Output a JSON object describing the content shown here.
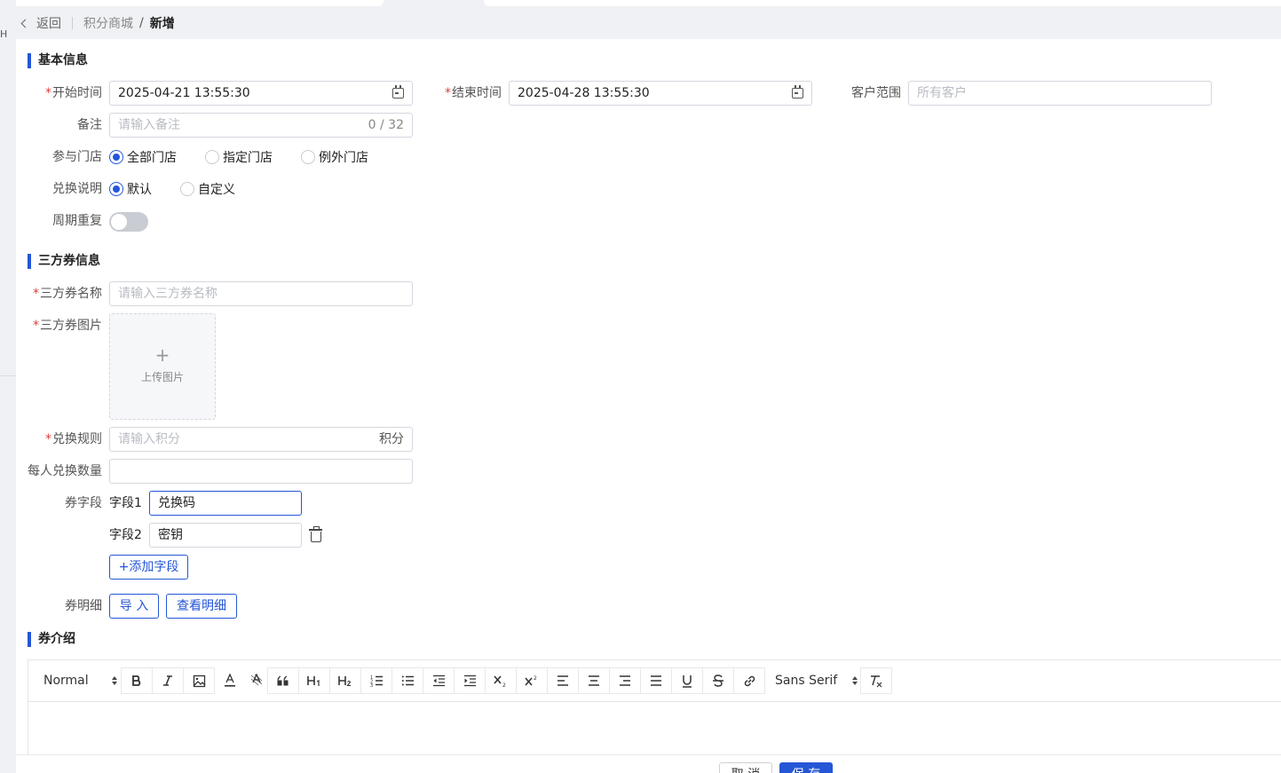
{
  "breadcrumb": {
    "back": "返回",
    "parent": "积分商城",
    "separator": "/",
    "current": "新增"
  },
  "left_edge_char": "H",
  "sections": {
    "basic": "基本信息",
    "coupon": "三方券信息",
    "intro": "券介绍"
  },
  "basic": {
    "start_time": {
      "label": "开始时间",
      "required": "*",
      "value": "2025-04-21 13:55:30"
    },
    "end_time": {
      "label": "结束时间",
      "required": "*",
      "value": "2025-04-28 13:55:30"
    },
    "customer_scope": {
      "label": "客户范围",
      "placeholder": "所有客户"
    },
    "remark": {
      "label": "备注",
      "placeholder": "请输入备注",
      "counter": "0 / 32"
    },
    "stores": {
      "label": "参与门店",
      "options": [
        "全部门店",
        "指定门店",
        "例外门店"
      ],
      "selected": "全部门店"
    },
    "exchange_desc": {
      "label": "兑换说明",
      "options": [
        "默认",
        "自定义"
      ],
      "selected": "默认"
    },
    "repeat": {
      "label": "周期重复",
      "on": false
    }
  },
  "coupon": {
    "name": {
      "label": "三方券名称",
      "required": "*",
      "placeholder": "请输入三方券名称"
    },
    "image": {
      "label": "三方券图片",
      "required": "*",
      "plus": "+",
      "upload_text": "上传图片"
    },
    "rule": {
      "label": "兑换规则",
      "required": "*",
      "placeholder": "请输入积分",
      "suffix": "积分"
    },
    "per_person": {
      "label": "每人兑换数量",
      "value": ""
    },
    "fields": {
      "label": "券字段",
      "items": [
        {
          "name": "字段1",
          "value": "兑换码"
        },
        {
          "name": "字段2",
          "value": "密钥"
        }
      ],
      "add_button": "+添加字段"
    },
    "details": {
      "label": "券明细",
      "import_button": "导 入",
      "view_button": "查看明细"
    }
  },
  "editor": {
    "header_select": "Normal",
    "font_select": "Sans Serif",
    "buttons": [
      "bold",
      "italic",
      "image",
      "font-color",
      "background-color",
      "blockquote",
      "header-1",
      "header-2",
      "ordered-list",
      "bullet-list",
      "indent-decrease",
      "indent-increase",
      "subscript",
      "superscript",
      "align-left",
      "align-center",
      "align-right",
      "align-justify",
      "underline",
      "strike",
      "link"
    ],
    "clean": "clean-format"
  },
  "footer": {
    "cancel": "取 消",
    "save": "保 存"
  },
  "colors": {
    "accent": "#2456d6",
    "required": "#e23c3c"
  }
}
